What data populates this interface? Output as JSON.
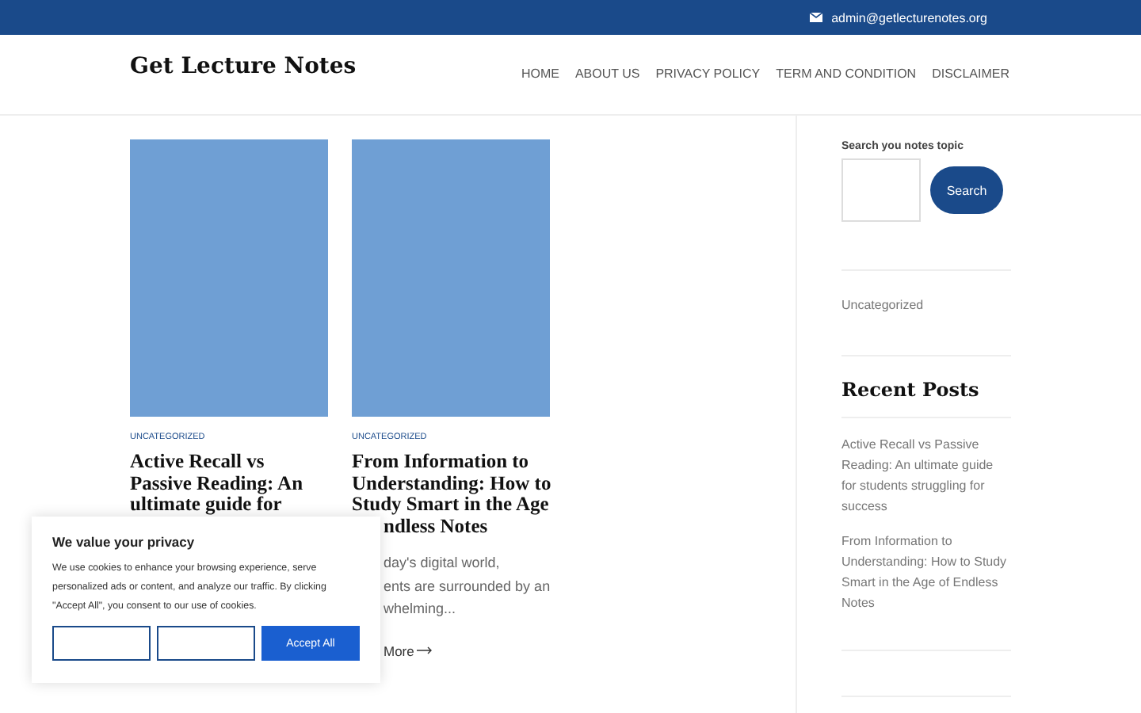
{
  "top_bar": {
    "email": "admin@getlecturenotes.org"
  },
  "header": {
    "site_title": "Get Lecture Notes",
    "nav": [
      "HOME",
      "ABOUT US",
      "PRIVACY POLICY",
      "TERM AND CONDITION",
      "DISCLAIMER"
    ]
  },
  "posts": [
    {
      "category": "UNCATEGORIZED",
      "title_lines": [
        "Active Recall vs",
        "Passive Reading: An",
        "ultimate guide for"
      ]
    },
    {
      "category": "UNCATEGORIZED",
      "title_lines": [
        "From Information to",
        "Understanding: How to",
        "Study Smart in the Age"
      ],
      "covered_title_lines": [
        "ndless Notes"
      ],
      "excerpt_lines": [
        "day's digital world,",
        "ents are surrounded by an",
        "whelming..."
      ],
      "read_more": "More"
    }
  ],
  "sidebar": {
    "search_label": "Search you notes topic",
    "search_button": "Search",
    "categories": [
      "Uncategorized"
    ],
    "recent_title": "Recent Posts",
    "recent_posts": [
      "Active Recall vs Passive Reading: An ultimate guide for students struggling for success",
      "From Information to Understanding: How to Study Smart in the Age of Endless Notes"
    ]
  },
  "cookie_banner": {
    "title": "We value your privacy",
    "text": "We use cookies to enhance your browsing experience, serve personalized ads or content, and analyze our traffic. By clicking \"Accept All\", you consent to our use of cookies.",
    "buttons": [
      {
        "kind": "outline"
      },
      {
        "kind": "outline"
      },
      {
        "kind": "primary",
        "label": "Accept All"
      }
    ]
  }
}
